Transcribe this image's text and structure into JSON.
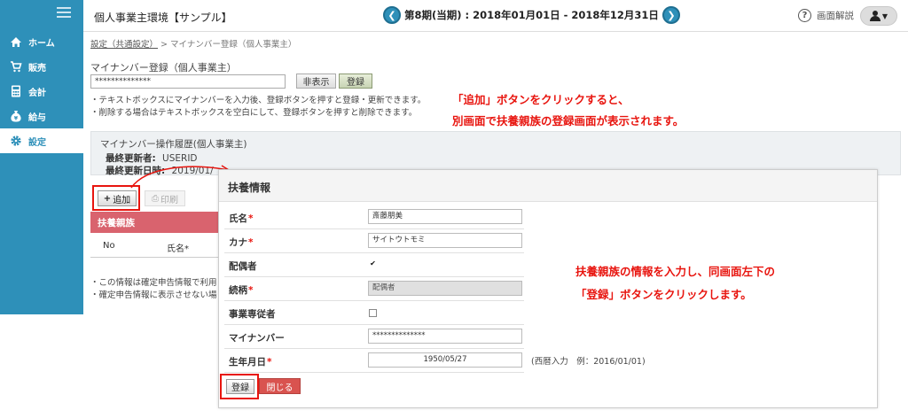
{
  "sidebar": {
    "items": [
      {
        "label": "ホーム",
        "icon": "home-icon"
      },
      {
        "label": "販売",
        "icon": "cart-icon"
      },
      {
        "label": "会計",
        "icon": "calculator-icon"
      },
      {
        "label": "給与",
        "icon": "money-bag-icon"
      },
      {
        "label": "設定",
        "icon": "gear-icon"
      }
    ]
  },
  "header": {
    "app_title": "個人事業主環境【サンプル】",
    "period": "第8期(当期) : 2018年01月01日 - 2018年12月31日",
    "help": "画面解説"
  },
  "breadcrumb": {
    "link": "設定（共通設定）",
    "sep": ">",
    "current": "マイナンバー登録（個人事業主）"
  },
  "mynumber": {
    "title": "マイナンバー登録（個人事業主）",
    "value": "**************",
    "hide_label": "非表示",
    "register_label": "登録",
    "note1": "・テキストボックスにマイナンバーを入力後、登録ボタンを押すと登録・更新できます。",
    "note2": "・削除する場合はテキストボックスを空白にして、登録ボタンを押すと削除できます。"
  },
  "annotations": {
    "top_line1": "「追加」ボタンをクリックすると、",
    "top_line2": "別画面で扶養親族の登録画面が表示されます。",
    "mid_line1": "扶養親族の情報を入力し、同画面左下の",
    "mid_line2": "「登録」ボタンをクリックします。"
  },
  "history": {
    "title": "マイナンバー操作履歴(個人事業主)",
    "updater_label": "最終更新者:",
    "updater_value": "USERID",
    "updated_label": "最終更新日時:",
    "updated_value": "2019/01/"
  },
  "toolbar": {
    "add_label": "追加",
    "print_label": "印刷"
  },
  "family": {
    "title": "扶養親族",
    "col_no": "No",
    "col_name": "氏名*",
    "note1": "・この情報は確定申告情報で利用",
    "note2": "・確定申告情報に表示させない場"
  },
  "modal": {
    "title": "扶養情報",
    "fields": [
      {
        "label": "氏名",
        "required": "*",
        "value": "斎藤朋美"
      },
      {
        "label": "カナ",
        "required": "*",
        "value": "サイトウトモミ"
      },
      {
        "label": "配偶者",
        "required": "",
        "checked": "✔"
      },
      {
        "label": "続柄",
        "required": "*",
        "value": "配偶者"
      },
      {
        "label": "事業専従者",
        "required": "",
        "checked": ""
      },
      {
        "label": "マイナンバー",
        "required": "",
        "value": "**************"
      },
      {
        "label": "生年月日",
        "required": "*",
        "value": "1950/05/27"
      }
    ],
    "birth_hint": "(西暦入力　例：2016/01/01)",
    "register_label": "登録",
    "close_label": "閉じる"
  },
  "colors": {
    "sidebar": "#2e90b9",
    "danger": "#e8150f",
    "family_header": "#d9636e"
  }
}
